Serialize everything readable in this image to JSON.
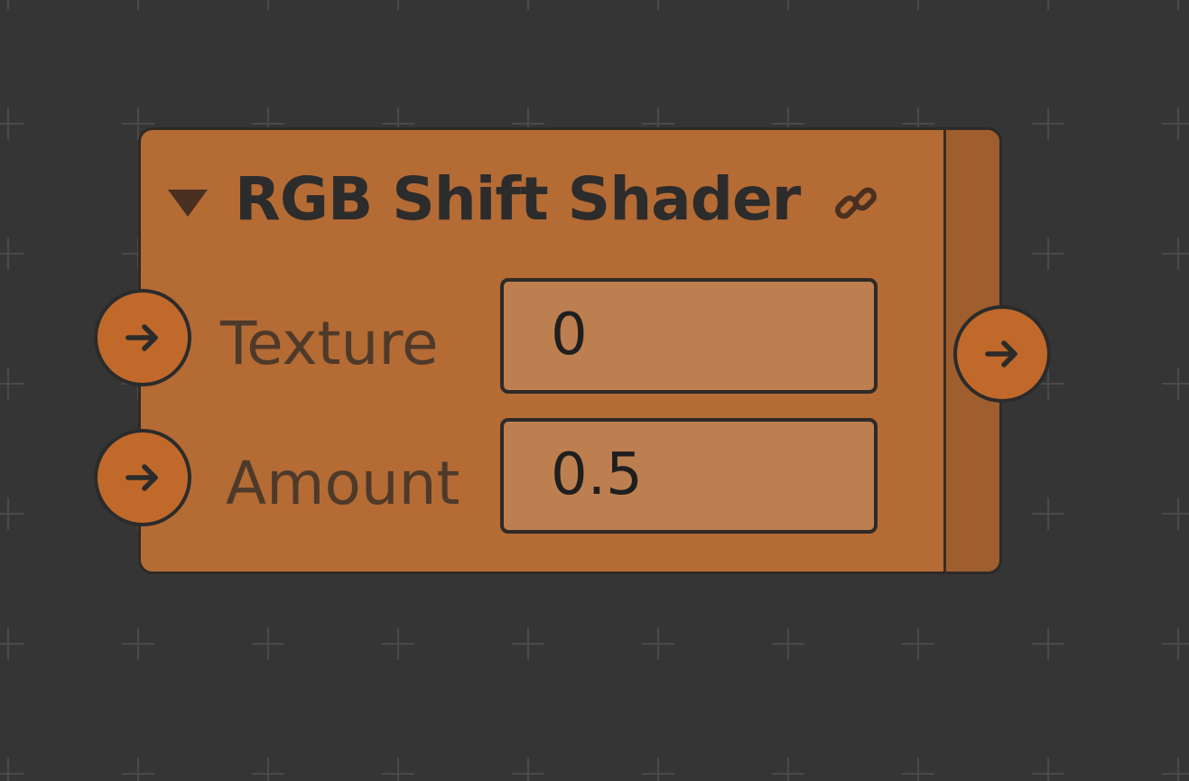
{
  "node": {
    "title": "RGB Shift Shader",
    "collapse_icon": "triangle-down-icon",
    "link_icon": "link-icon",
    "inputs": [
      {
        "label": "Texture",
        "value": "0",
        "port_icon": "arrow-right-icon"
      },
      {
        "label": "Amount",
        "value": "0.5",
        "port_icon": "arrow-right-icon"
      }
    ],
    "output": {
      "port_icon": "arrow-right-icon"
    }
  },
  "colors": {
    "canvas_background": "#353535",
    "node_body": "#b56b34",
    "node_side_strip": "#9e5e2e",
    "port_fill": "#c0692b",
    "field_fill": "#be7f50"
  }
}
